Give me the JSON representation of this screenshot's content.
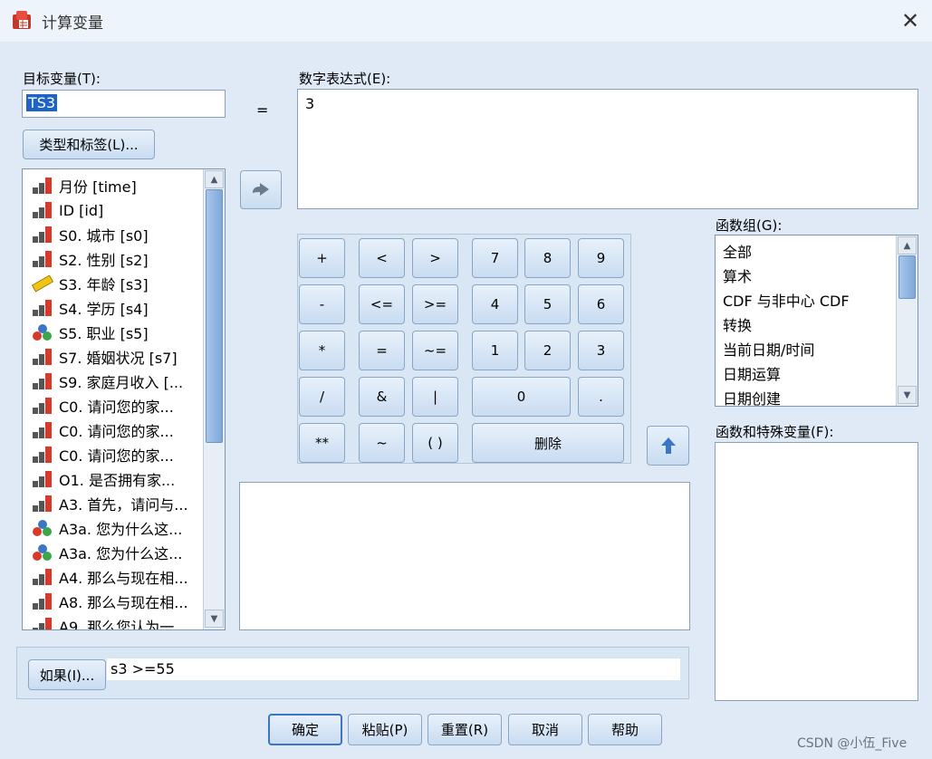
{
  "window": {
    "title": "计算变量",
    "close_glyph": "✕"
  },
  "target_var": {
    "label": "目标变量(T):",
    "value": "TS3"
  },
  "equals": "=",
  "type_label_button": "类型和标签(L)...",
  "numeric_expr": {
    "label": "数字表达式(E):",
    "value": "3"
  },
  "variables": [
    {
      "text": "月份 [time]",
      "type": "scale"
    },
    {
      "text": "ID [id]",
      "type": "scale"
    },
    {
      "text": "S0. 城市 [s0]",
      "type": "scale"
    },
    {
      "text": "S2. 性别 [s2]",
      "type": "scale"
    },
    {
      "text": "S3. 年龄 [s3]",
      "type": "ruler"
    },
    {
      "text": "S4. 学历 [s4]",
      "type": "scale"
    },
    {
      "text": "S5. 职业 [s5]",
      "type": "nominal"
    },
    {
      "text": "S7. 婚姻状况 [s7]",
      "type": "scale"
    },
    {
      "text": "S9. 家庭月收入 [...",
      "type": "scale"
    },
    {
      "text": "C0. 请问您的家...",
      "type": "scale"
    },
    {
      "text": "C0. 请问您的家...",
      "type": "scale"
    },
    {
      "text": "C0. 请问您的家...",
      "type": "scale"
    },
    {
      "text": "O1. 是否拥有家...",
      "type": "scale"
    },
    {
      "text": "A3. 首先，请问与...",
      "type": "scale"
    },
    {
      "text": "A3a. 您为什么这...",
      "type": "nominal"
    },
    {
      "text": "A3a. 您为什么这...",
      "type": "nominal"
    },
    {
      "text": "A4. 那么与现在相...",
      "type": "scale"
    },
    {
      "text": "A8. 那么与现在相...",
      "type": "scale"
    },
    {
      "text": "A9. 那么您认为一...",
      "type": "scale"
    }
  ],
  "calc": {
    "plus": "+",
    "lt": "<",
    "gt": ">",
    "n7": "7",
    "n8": "8",
    "n9": "9",
    "minus": "-",
    "le": "<=",
    "ge": ">=",
    "n4": "4",
    "n5": "5",
    "n6": "6",
    "mult": "*",
    "eq": "=",
    "ne": "~=",
    "n1": "1",
    "n2": "2",
    "n3": "3",
    "div": "/",
    "and": "&",
    "or": "|",
    "n0": "0",
    "dot": ".",
    "pow": "**",
    "not": "~",
    "paren": "( )",
    "delete": "删除"
  },
  "func_group": {
    "label": "函数组(G):",
    "items": [
      "全部",
      "算术",
      "CDF 与非中心 CDF",
      "转换",
      "当前日期/时间",
      "日期运算",
      "日期创建"
    ]
  },
  "func_special": {
    "label": "函数和特殊变量(F):"
  },
  "if_button": "如果(I)...",
  "if_condition": "s3 >=55",
  "buttons": {
    "ok": "确定",
    "paste": "粘贴(P)",
    "reset": "重置(R)",
    "cancel": "取消",
    "help": "帮助"
  },
  "watermark": "CSDN @小伍_Five",
  "colors": {
    "accent": "#3b76c4",
    "selection": "#1e63c6",
    "bar_red": "#d63a2b",
    "bar_gray": "#555555"
  }
}
